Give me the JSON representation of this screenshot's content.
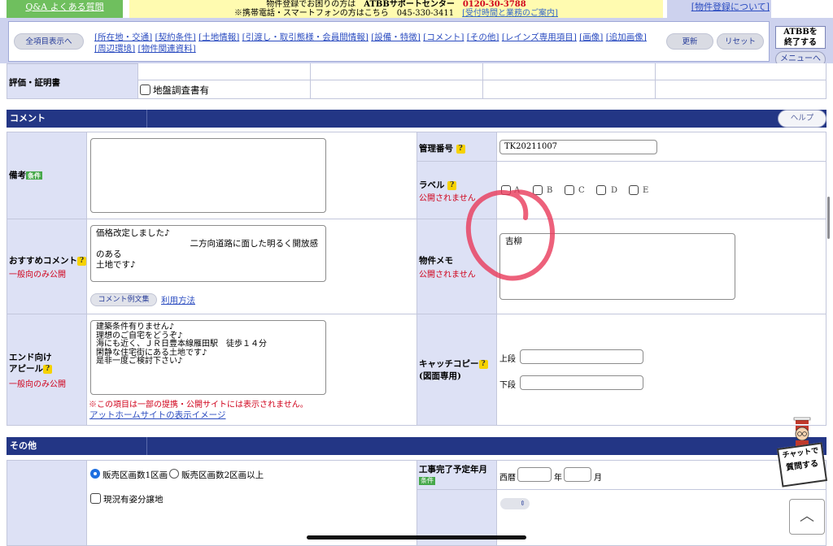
{
  "header": {
    "qa_link": "Q&A よくある質問",
    "info_line1_prefix": "物件登録でお困りの方は",
    "info_center_name": "ATBBサポートセンター",
    "info_phone": "0120-30-3788",
    "info_line2": "※携帯電話・スマートフォンの方はこちら　045-330-3411",
    "info_hours_link": "[受付時間と業務のご案内]",
    "reg_link": "[物件登録について]",
    "exit_button": "ATBBを\n終了する",
    "menu_button": "メニューへ"
  },
  "nav": {
    "show_all_button": "全項目表示へ",
    "links": [
      "[所在地・交通]",
      "[契約条件]",
      "[土地情報]",
      "[引渡し・取引態様・会員間情報]",
      "[設備・特徴]",
      "[コメント]",
      "[その他]",
      "[レインズ専用項目]",
      "[画像]",
      "[追加画像]",
      "[周辺環境]",
      "[物件関連資料]"
    ],
    "update_button": "更新",
    "reset_button": "リセット"
  },
  "top_row": {
    "label": "評価・証明書",
    "checkbox_label": "地盤調査書有"
  },
  "comment_section": {
    "title": "コメント",
    "help_button": "ヘルプ",
    "remarks_label": "備考",
    "remarks_badge": "条件",
    "recommend_label": "おすすめコメント",
    "recommend_scope": "一般向のみ公開",
    "recommend_text": "価格改定しました♪\n　　　　　　　　　　　二方向道路に面した明るく開放感のある\n土地です♪",
    "comment_examples_button": "コメント例文集",
    "usage_link": "利用方法",
    "end_label_1": "エンド向け",
    "end_label_2": "アピール",
    "end_scope": "一般向のみ公開",
    "end_text": "建築条件有りません♪\n理想のご自宅をどうぞ♪\n海にも近く、ＪＲ日豊本線雁田駅　徒歩１４分\n閑静な住宅街にある土地です♪\n是非一度ご検討下さい♪",
    "end_note": "※この項目は一部の提携・公開サイトには表示されません。",
    "at_home_link": "アットホームサイトの表示イメージ",
    "mgmt_label": "管理番号",
    "mgmt_value": "TK20211007",
    "label_label": "ラベル",
    "label_scope": "公開されません",
    "label_options": [
      "A",
      "B",
      "C",
      "D",
      "E"
    ],
    "memo_label": "物件メモ",
    "memo_scope": "公開されません",
    "memo_value": "吉柳",
    "catch_label": "キャッチコピー",
    "catch_sub": "(図面専用)",
    "catch_upper": "上段",
    "catch_lower": "下段"
  },
  "other_section": {
    "title": "その他",
    "radio_1": "販売区画数1区画",
    "radio_2": "販売区画数2区画以上",
    "checkbox_status": "現況有姿分譲地",
    "completion_label": "工事完了予定年月",
    "completion_badge": "条件",
    "era": "西暦",
    "year_unit": "年",
    "month_unit": "月"
  },
  "chat_widget": {
    "text_1": "チャットで",
    "text_2": "質問する"
  },
  "colors": {
    "section_bar": "#233685",
    "label_bg": "#dde1f5",
    "annotation": "#e83a5a"
  }
}
